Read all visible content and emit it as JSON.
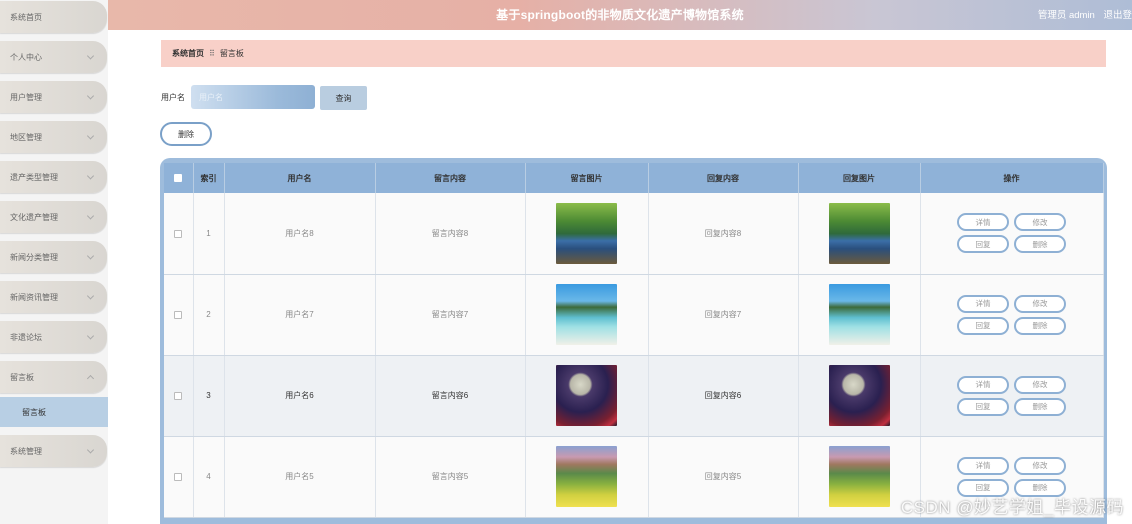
{
  "sidebar": {
    "items": [
      {
        "label": "系统首页",
        "chevron": ""
      },
      {
        "label": "个人中心",
        "chevron": "down"
      },
      {
        "label": "用户管理",
        "chevron": "down"
      },
      {
        "label": "地区管理",
        "chevron": "down"
      },
      {
        "label": "遗产类型管理",
        "chevron": "down"
      },
      {
        "label": "文化遗产管理",
        "chevron": "down"
      },
      {
        "label": "新闻分类管理",
        "chevron": "down"
      },
      {
        "label": "新闻资讯管理",
        "chevron": "down"
      },
      {
        "label": "非遗论坛",
        "chevron": "down"
      },
      {
        "label": "留言板",
        "chevron": "up"
      },
      {
        "label": "系统管理",
        "chevron": "down"
      }
    ],
    "active_sub": "留言板"
  },
  "header": {
    "title": "基于springboot的非物质文化遗产博物馆系统",
    "user": "管理员 admin",
    "logout": "退出登"
  },
  "breadcrumb": {
    "home": "系统首页",
    "separator": "⠿",
    "current": "留言板"
  },
  "search": {
    "label": "用户名",
    "placeholder": "用户名",
    "button": "查询"
  },
  "actions": {
    "delete": "删除"
  },
  "table": {
    "columns": [
      "",
      "索引",
      "用户名",
      "留言内容",
      "留言图片",
      "回复内容",
      "回复图片",
      "操作"
    ],
    "rows": [
      {
        "index": "1",
        "user": "用户名8",
        "message": "留言内容8",
        "image": "forest-photo",
        "reply": "回复内容8",
        "reply_image": "forest-photo"
      },
      {
        "index": "2",
        "user": "用户名7",
        "message": "留言内容7",
        "image": "beach-photo",
        "reply": "回复内容7",
        "reply_image": "beach-photo"
      },
      {
        "index": "3",
        "user": "用户名6",
        "message": "留言内容6",
        "image": "moon-photo",
        "reply": "回复内容6",
        "reply_image": "moon-photo"
      },
      {
        "index": "4",
        "user": "用户名5",
        "message": "留言内容5",
        "image": "meadow-photo",
        "reply": "回复内容5",
        "reply_image": "meadow-photo"
      }
    ],
    "row_actions": {
      "detail": "详情",
      "edit": "修改",
      "reply": "回复",
      "delete": "删除"
    }
  },
  "watermark": "CSDN @妙艺学姐_毕设源码"
}
